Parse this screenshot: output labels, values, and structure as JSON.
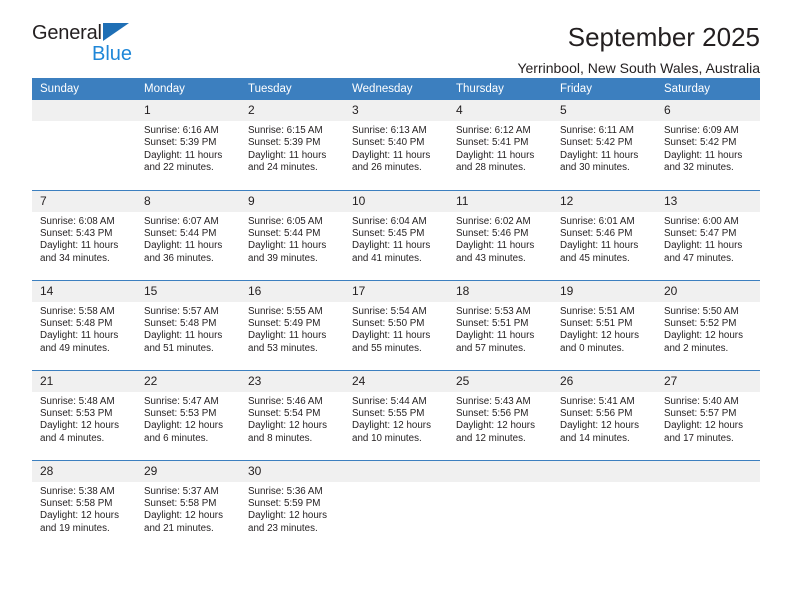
{
  "brand": {
    "name_top": "General",
    "name_bottom": "Blue",
    "triangle_color": "#1f6fb5",
    "blue_color": "#1f87d8"
  },
  "header": {
    "title": "September 2025",
    "subtitle": "Yerrinbool, New South Wales, Australia"
  },
  "theme": {
    "header_blue": "#3c7fbf",
    "daynum_bg": "#f0f0f0",
    "text": "#231f20"
  },
  "weekday_headers": [
    "Sunday",
    "Monday",
    "Tuesday",
    "Wednesday",
    "Thursday",
    "Friday",
    "Saturday"
  ],
  "weeks": [
    [
      {
        "day": "",
        "sunrise": "",
        "sunset": "",
        "daylight_line1": "",
        "daylight_line2": ""
      },
      {
        "day": "1",
        "sunrise": "Sunrise: 6:16 AM",
        "sunset": "Sunset: 5:39 PM",
        "daylight_line1": "Daylight: 11 hours",
        "daylight_line2": "and 22 minutes."
      },
      {
        "day": "2",
        "sunrise": "Sunrise: 6:15 AM",
        "sunset": "Sunset: 5:39 PM",
        "daylight_line1": "Daylight: 11 hours",
        "daylight_line2": "and 24 minutes."
      },
      {
        "day": "3",
        "sunrise": "Sunrise: 6:13 AM",
        "sunset": "Sunset: 5:40 PM",
        "daylight_line1": "Daylight: 11 hours",
        "daylight_line2": "and 26 minutes."
      },
      {
        "day": "4",
        "sunrise": "Sunrise: 6:12 AM",
        "sunset": "Sunset: 5:41 PM",
        "daylight_line1": "Daylight: 11 hours",
        "daylight_line2": "and 28 minutes."
      },
      {
        "day": "5",
        "sunrise": "Sunrise: 6:11 AM",
        "sunset": "Sunset: 5:42 PM",
        "daylight_line1": "Daylight: 11 hours",
        "daylight_line2": "and 30 minutes."
      },
      {
        "day": "6",
        "sunrise": "Sunrise: 6:09 AM",
        "sunset": "Sunset: 5:42 PM",
        "daylight_line1": "Daylight: 11 hours",
        "daylight_line2": "and 32 minutes."
      }
    ],
    [
      {
        "day": "7",
        "sunrise": "Sunrise: 6:08 AM",
        "sunset": "Sunset: 5:43 PM",
        "daylight_line1": "Daylight: 11 hours",
        "daylight_line2": "and 34 minutes."
      },
      {
        "day": "8",
        "sunrise": "Sunrise: 6:07 AM",
        "sunset": "Sunset: 5:44 PM",
        "daylight_line1": "Daylight: 11 hours",
        "daylight_line2": "and 36 minutes."
      },
      {
        "day": "9",
        "sunrise": "Sunrise: 6:05 AM",
        "sunset": "Sunset: 5:44 PM",
        "daylight_line1": "Daylight: 11 hours",
        "daylight_line2": "and 39 minutes."
      },
      {
        "day": "10",
        "sunrise": "Sunrise: 6:04 AM",
        "sunset": "Sunset: 5:45 PM",
        "daylight_line1": "Daylight: 11 hours",
        "daylight_line2": "and 41 minutes."
      },
      {
        "day": "11",
        "sunrise": "Sunrise: 6:02 AM",
        "sunset": "Sunset: 5:46 PM",
        "daylight_line1": "Daylight: 11 hours",
        "daylight_line2": "and 43 minutes."
      },
      {
        "day": "12",
        "sunrise": "Sunrise: 6:01 AM",
        "sunset": "Sunset: 5:46 PM",
        "daylight_line1": "Daylight: 11 hours",
        "daylight_line2": "and 45 minutes."
      },
      {
        "day": "13",
        "sunrise": "Sunrise: 6:00 AM",
        "sunset": "Sunset: 5:47 PM",
        "daylight_line1": "Daylight: 11 hours",
        "daylight_line2": "and 47 minutes."
      }
    ],
    [
      {
        "day": "14",
        "sunrise": "Sunrise: 5:58 AM",
        "sunset": "Sunset: 5:48 PM",
        "daylight_line1": "Daylight: 11 hours",
        "daylight_line2": "and 49 minutes."
      },
      {
        "day": "15",
        "sunrise": "Sunrise: 5:57 AM",
        "sunset": "Sunset: 5:48 PM",
        "daylight_line1": "Daylight: 11 hours",
        "daylight_line2": "and 51 minutes."
      },
      {
        "day": "16",
        "sunrise": "Sunrise: 5:55 AM",
        "sunset": "Sunset: 5:49 PM",
        "daylight_line1": "Daylight: 11 hours",
        "daylight_line2": "and 53 minutes."
      },
      {
        "day": "17",
        "sunrise": "Sunrise: 5:54 AM",
        "sunset": "Sunset: 5:50 PM",
        "daylight_line1": "Daylight: 11 hours",
        "daylight_line2": "and 55 minutes."
      },
      {
        "day": "18",
        "sunrise": "Sunrise: 5:53 AM",
        "sunset": "Sunset: 5:51 PM",
        "daylight_line1": "Daylight: 11 hours",
        "daylight_line2": "and 57 minutes."
      },
      {
        "day": "19",
        "sunrise": "Sunrise: 5:51 AM",
        "sunset": "Sunset: 5:51 PM",
        "daylight_line1": "Daylight: 12 hours",
        "daylight_line2": "and 0 minutes."
      },
      {
        "day": "20",
        "sunrise": "Sunrise: 5:50 AM",
        "sunset": "Sunset: 5:52 PM",
        "daylight_line1": "Daylight: 12 hours",
        "daylight_line2": "and 2 minutes."
      }
    ],
    [
      {
        "day": "21",
        "sunrise": "Sunrise: 5:48 AM",
        "sunset": "Sunset: 5:53 PM",
        "daylight_line1": "Daylight: 12 hours",
        "daylight_line2": "and 4 minutes."
      },
      {
        "day": "22",
        "sunrise": "Sunrise: 5:47 AM",
        "sunset": "Sunset: 5:53 PM",
        "daylight_line1": "Daylight: 12 hours",
        "daylight_line2": "and 6 minutes."
      },
      {
        "day": "23",
        "sunrise": "Sunrise: 5:46 AM",
        "sunset": "Sunset: 5:54 PM",
        "daylight_line1": "Daylight: 12 hours",
        "daylight_line2": "and 8 minutes."
      },
      {
        "day": "24",
        "sunrise": "Sunrise: 5:44 AM",
        "sunset": "Sunset: 5:55 PM",
        "daylight_line1": "Daylight: 12 hours",
        "daylight_line2": "and 10 minutes."
      },
      {
        "day": "25",
        "sunrise": "Sunrise: 5:43 AM",
        "sunset": "Sunset: 5:56 PM",
        "daylight_line1": "Daylight: 12 hours",
        "daylight_line2": "and 12 minutes."
      },
      {
        "day": "26",
        "sunrise": "Sunrise: 5:41 AM",
        "sunset": "Sunset: 5:56 PM",
        "daylight_line1": "Daylight: 12 hours",
        "daylight_line2": "and 14 minutes."
      },
      {
        "day": "27",
        "sunrise": "Sunrise: 5:40 AM",
        "sunset": "Sunset: 5:57 PM",
        "daylight_line1": "Daylight: 12 hours",
        "daylight_line2": "and 17 minutes."
      }
    ],
    [
      {
        "day": "28",
        "sunrise": "Sunrise: 5:38 AM",
        "sunset": "Sunset: 5:58 PM",
        "daylight_line1": "Daylight: 12 hours",
        "daylight_line2": "and 19 minutes."
      },
      {
        "day": "29",
        "sunrise": "Sunrise: 5:37 AM",
        "sunset": "Sunset: 5:58 PM",
        "daylight_line1": "Daylight: 12 hours",
        "daylight_line2": "and 21 minutes."
      },
      {
        "day": "30",
        "sunrise": "Sunrise: 5:36 AM",
        "sunset": "Sunset: 5:59 PM",
        "daylight_line1": "Daylight: 12 hours",
        "daylight_line2": "and 23 minutes."
      },
      {
        "day": "",
        "sunrise": "",
        "sunset": "",
        "daylight_line1": "",
        "daylight_line2": ""
      },
      {
        "day": "",
        "sunrise": "",
        "sunset": "",
        "daylight_line1": "",
        "daylight_line2": ""
      },
      {
        "day": "",
        "sunrise": "",
        "sunset": "",
        "daylight_line1": "",
        "daylight_line2": ""
      },
      {
        "day": "",
        "sunrise": "",
        "sunset": "",
        "daylight_line1": "",
        "daylight_line2": ""
      }
    ]
  ]
}
